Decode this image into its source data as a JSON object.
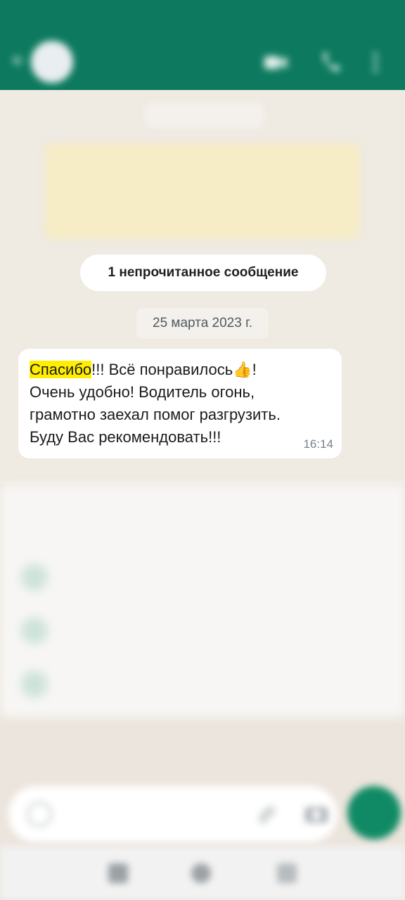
{
  "status_bar": {
    "left": "",
    "time": ""
  },
  "header": {
    "contact_name": "",
    "icons": [
      "back-arrow-icon",
      "video-call-icon",
      "phone-icon",
      "more-vert-icon"
    ]
  },
  "chat": {
    "old_date_chip": "",
    "encryption_notice": "",
    "unread_chip": "1 непрочитанное сообщение",
    "date_chip": "25 марта 2023 г.",
    "message": {
      "highlighted_word": "Спасибо",
      "line1_rest": "!!! Всё понравилось",
      "emoji": "👍",
      "line1_end": "!",
      "line2": "Очень удобно! Водитель  огонь,",
      "line3": "грамотно заехал помог разгрузить.",
      "line4": "Буду Вас рекомендовать!!!",
      "time": "16:14"
    }
  },
  "sheet": {
    "text": "",
    "items": [
      {
        "label": "",
        "icon": "check-icon"
      },
      {
        "label": "",
        "icon": "archive-icon"
      },
      {
        "label": "",
        "icon": "add-contact-icon"
      }
    ]
  },
  "composer": {
    "placeholder": ""
  },
  "colors": {
    "header_green": "#0d7a5f",
    "chat_bg": "#efeae2",
    "highlight": "#ffee00",
    "mic_green": "#0f8a64"
  }
}
